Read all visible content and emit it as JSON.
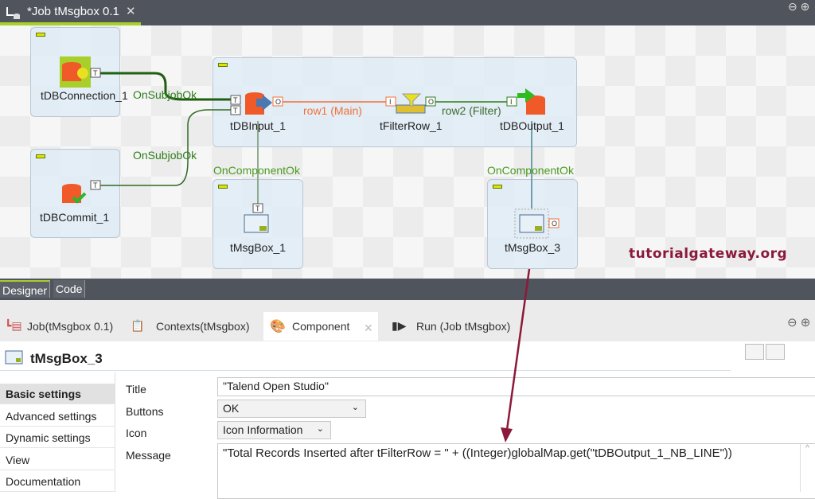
{
  "editor_tab": {
    "title": "*Job tMsgbox 0.1",
    "icon": "job-icon"
  },
  "canvas": {
    "components": [
      {
        "name": "tDBConnection_1",
        "icon": "db-connection-icon"
      },
      {
        "name": "tDBCommit_1",
        "icon": "db-commit-icon"
      },
      {
        "name": "tDBInput_1",
        "icon": "db-input-icon"
      },
      {
        "name": "tFilterRow_1",
        "icon": "filter-icon"
      },
      {
        "name": "tDBOutput_1",
        "icon": "db-output-icon"
      },
      {
        "name": "tMsgBox_1",
        "icon": "msgbox-icon"
      },
      {
        "name": "tMsgBox_3",
        "icon": "msgbox-icon"
      }
    ],
    "links": {
      "subjob1": "OnSubjobOk",
      "subjob2": "OnSubjobOk",
      "row1": "row1 (Main)",
      "row2": "row2 (Filter)",
      "comp1": "OnComponentOk",
      "comp2": "OnComponentOk"
    },
    "watermark": "tutorialgateway.org"
  },
  "designer_tabs": [
    "Designer",
    "Code"
  ],
  "view_tabs": [
    {
      "label": "Job(tMsgbox 0.1)",
      "icon": "job-icon"
    },
    {
      "label": "Contexts(tMsgbox)",
      "icon": "contexts-icon"
    },
    {
      "label": "Component",
      "icon": "component-icon",
      "active": true
    },
    {
      "label": "Run (Job tMsgbox)",
      "icon": "run-icon"
    }
  ],
  "component": {
    "title": "tMsgBox_3",
    "sections": [
      "Basic settings",
      "Advanced settings",
      "Dynamic settings",
      "View",
      "Documentation"
    ],
    "fields": {
      "title_label": "Title",
      "title_value": "\"Talend Open Studio\"",
      "buttons_label": "Buttons",
      "buttons_value": "OK",
      "icon_label": "Icon",
      "icon_value": "Icon Information",
      "message_label": "Message",
      "message_value": "\"Total Records Inserted after tFilterRow = \" + ((Integer)globalMap.get(\"tDBOutput_1_NB_LINE\"))"
    }
  },
  "colors": {
    "accent": "#a8cf2a",
    "main_link": "#f0703a",
    "trigger_link": "#2e7d1a",
    "annotation_arrow": "#8b1a3a"
  }
}
